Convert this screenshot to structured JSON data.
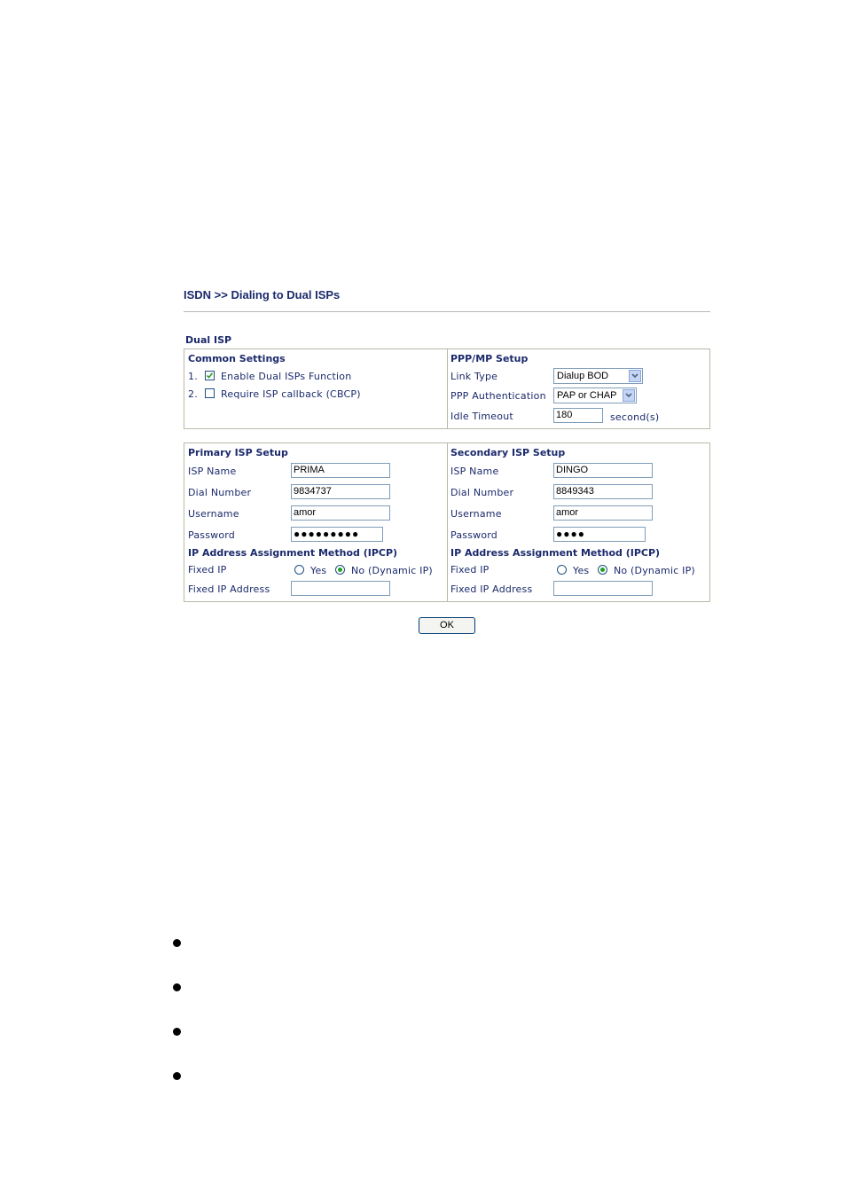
{
  "page": {
    "title": "ISDN >> Dialing to Dual ISPs",
    "section_label": "Dual ISP"
  },
  "common": {
    "header": "Common Settings",
    "items": [
      {
        "num": "1.",
        "label": "Enable Dual ISPs Function",
        "checked": true
      },
      {
        "num": "2.",
        "label": "Require ISP callback (CBCP)",
        "checked": false
      }
    ]
  },
  "ppp": {
    "header": "PPP/MP Setup",
    "link_type_label": "Link Type",
    "link_type_value": "Dialup BOD",
    "auth_label": "PPP Authentication",
    "auth_value": "PAP or CHAP",
    "idle_label": "Idle Timeout",
    "idle_value": "180",
    "idle_unit": "second(s)"
  },
  "primary": {
    "header": "Primary ISP Setup",
    "isp_name_label": "ISP Name",
    "isp_name_value": "PRIMA",
    "dial_label": "Dial Number",
    "dial_value": "9834737",
    "user_label": "Username",
    "user_value": "amor",
    "pass_label": "Password",
    "pass_value": "●●●●●●●●●",
    "ipcp_header": "IP Address Assignment Method (IPCP)",
    "fixed_ip_label": "Fixed IP",
    "yes_label": "Yes",
    "no_label": "No (Dynamic IP)",
    "fixed_ip_selected": "no",
    "fixed_addr_label": "Fixed IP Address",
    "fixed_addr_value": ""
  },
  "secondary": {
    "header": "Secondary ISP Setup",
    "isp_name_label": "ISP Name",
    "isp_name_value": "DINGO",
    "dial_label": "Dial Number",
    "dial_value": "8849343",
    "user_label": "Username",
    "user_value": "amor",
    "pass_label": "Password",
    "pass_value": "●●●●",
    "ipcp_header": "IP Address Assignment Method (IPCP)",
    "fixed_ip_label": "Fixed IP",
    "yes_label": "Yes",
    "no_label": "No (Dynamic IP)",
    "fixed_ip_selected": "no",
    "fixed_addr_label": "Fixed IP Address",
    "fixed_addr_value": ""
  },
  "ok_label": "OK",
  "colors": {
    "text": "#1b2a6b",
    "border": "#b9b9a8",
    "radio_selected": "#21a121"
  }
}
